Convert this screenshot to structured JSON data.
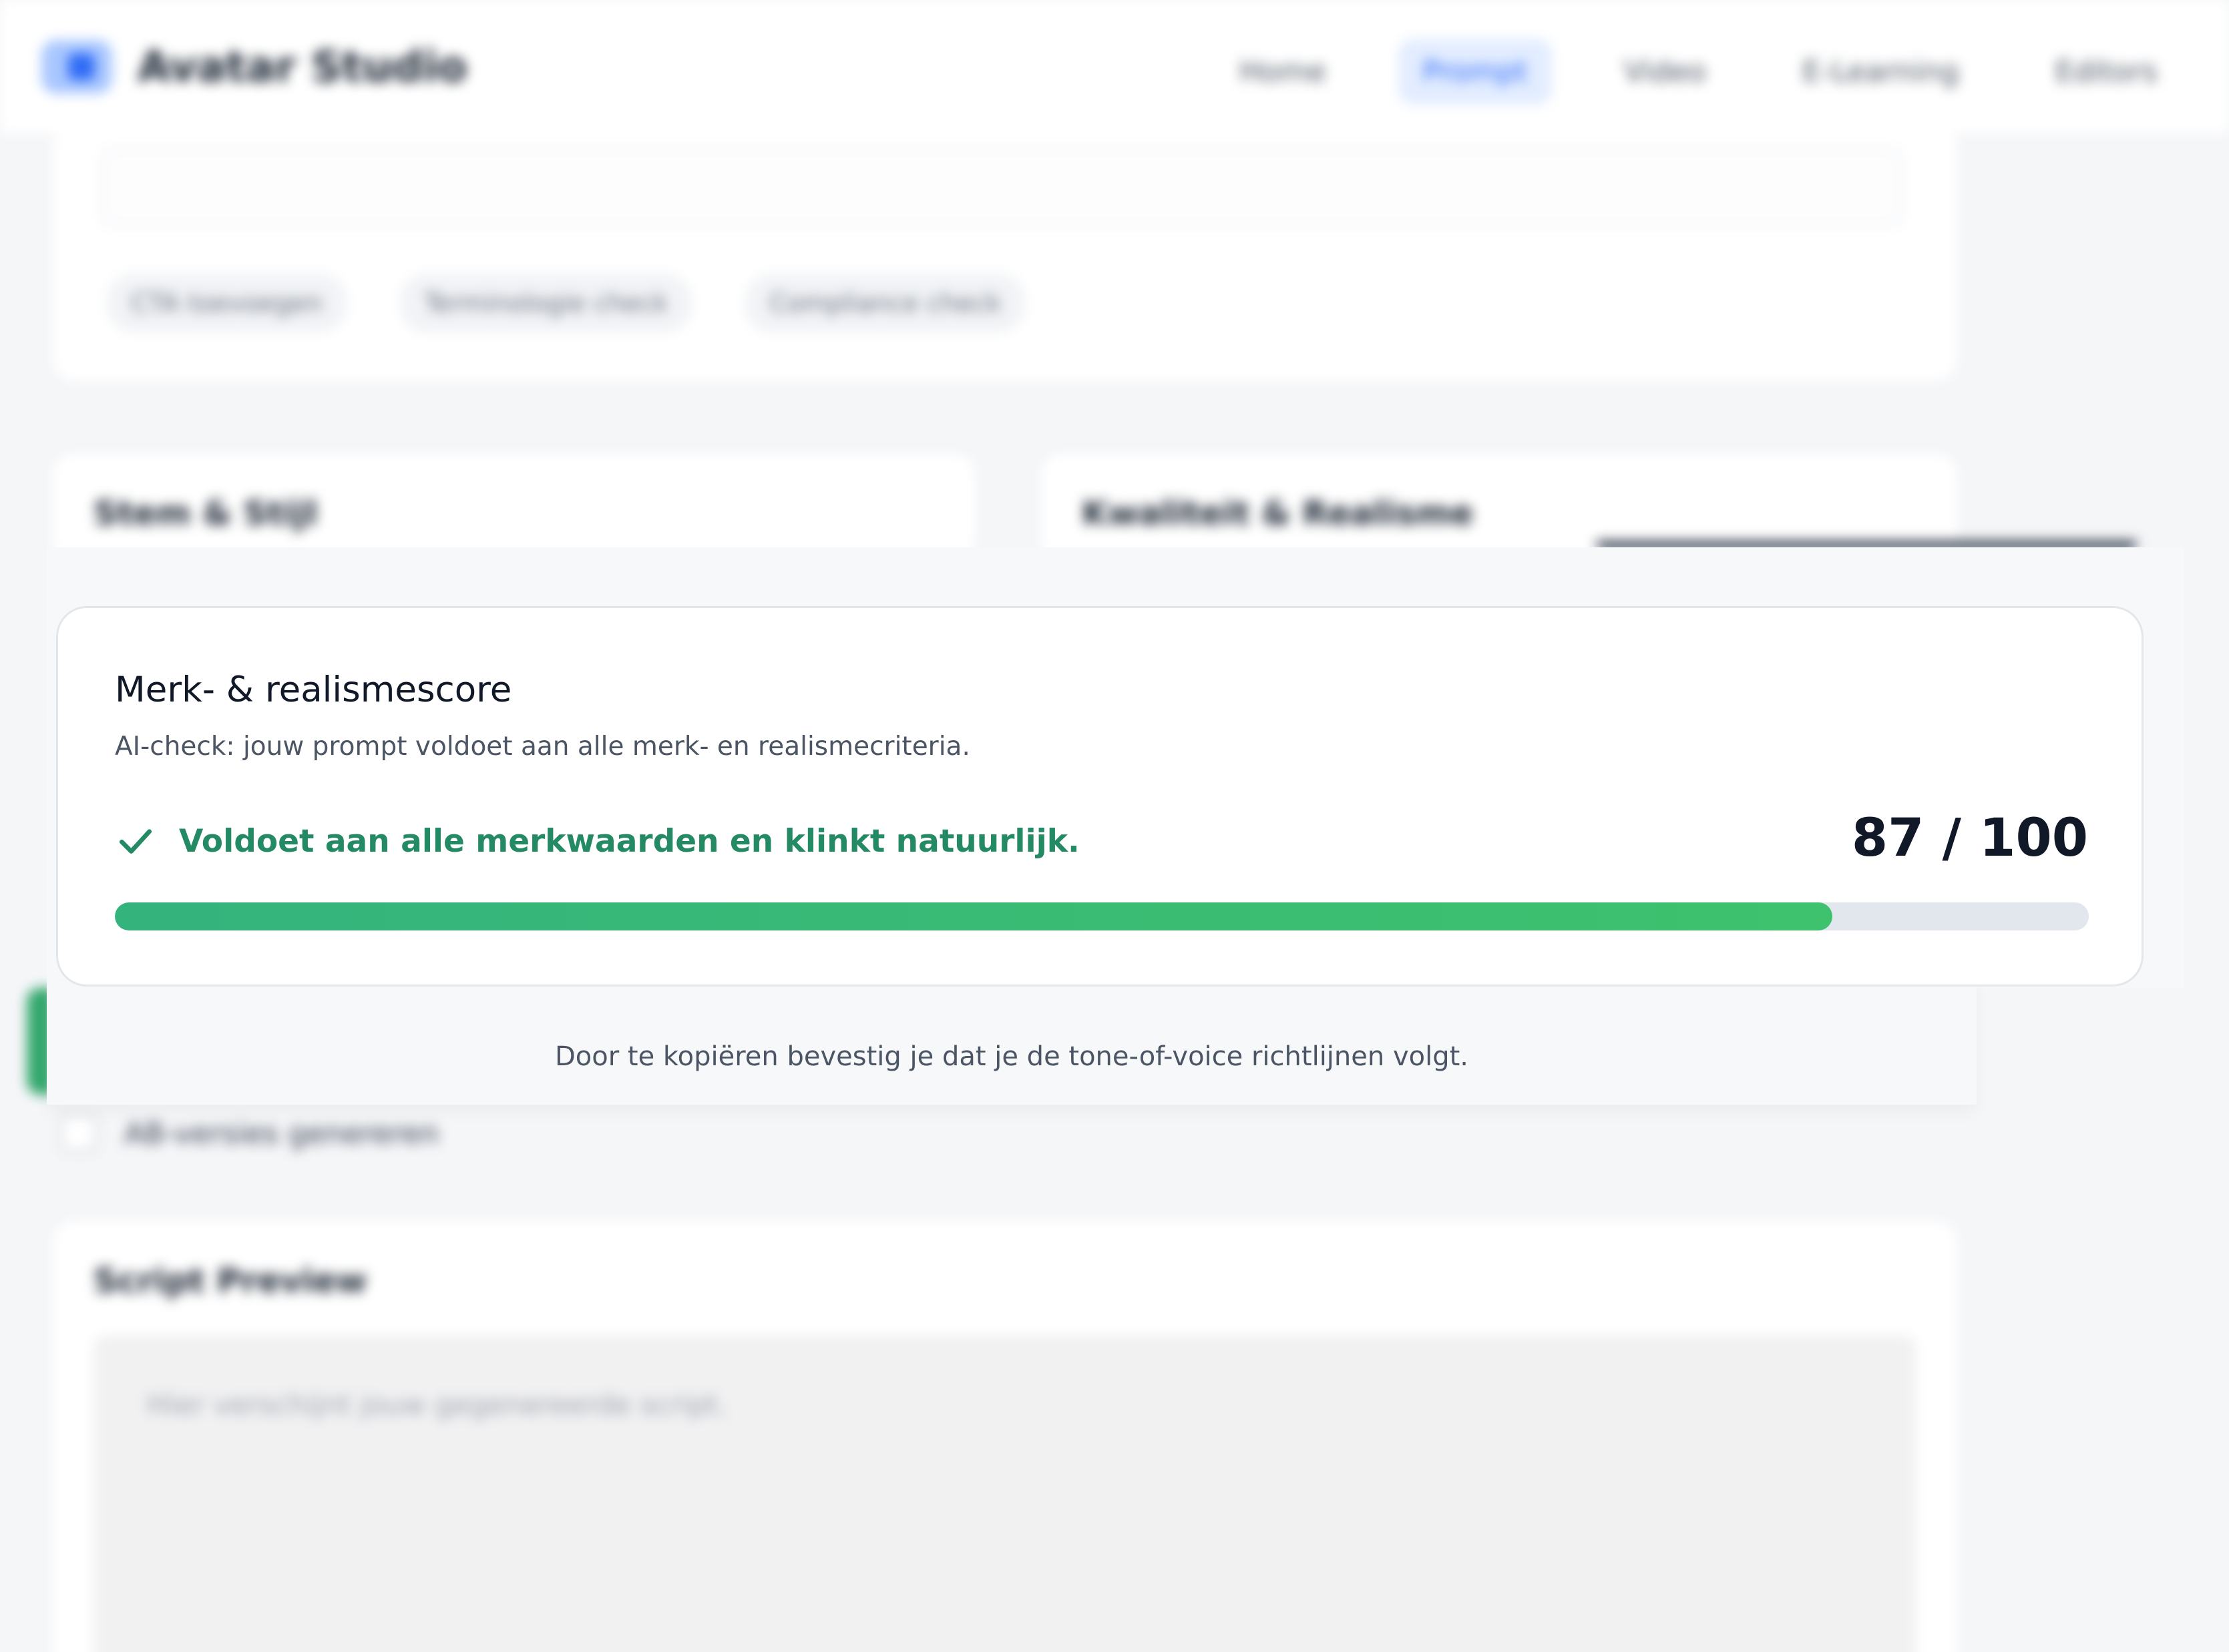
{
  "app": {
    "title": "Avatar Studio",
    "nav": [
      "Home",
      "Prompt",
      "Video",
      "E-Learning",
      "Editors"
    ],
    "active_nav": "Prompt"
  },
  "prompt_card": {
    "chips": [
      "CTA toevoegen",
      "Terminologie check",
      "Compliance check"
    ]
  },
  "sections": {
    "left_heading": "Stem & Stijl",
    "right_heading": "Kwaliteit & Realisme"
  },
  "options": {
    "toggle_label": "AB-versies genereren"
  },
  "script_preview": {
    "heading": "Script Preview",
    "placeholder": "Hier verschijnt jouw gegenereerde script."
  },
  "score_panel": {
    "title": "Merk- & realismescore",
    "subtitle": "AI-check: jouw prompt voldoet aan alle merk- en realismecriteria.",
    "status": "Voldoet aan alle merkwaarden en klinkt natuurlijk.",
    "status_icon": "check-icon",
    "score_label": "87 / 100",
    "score": 87,
    "max_score": 100,
    "colors": {
      "status": "#238a63",
      "bar_start": "#34b37d",
      "bar_end": "#3ec26d",
      "track": "#e2e7ed"
    }
  },
  "footer": {
    "note": "Door te kopiëren bevestig je dat je de tone-of-voice richtlijnen volgt."
  }
}
